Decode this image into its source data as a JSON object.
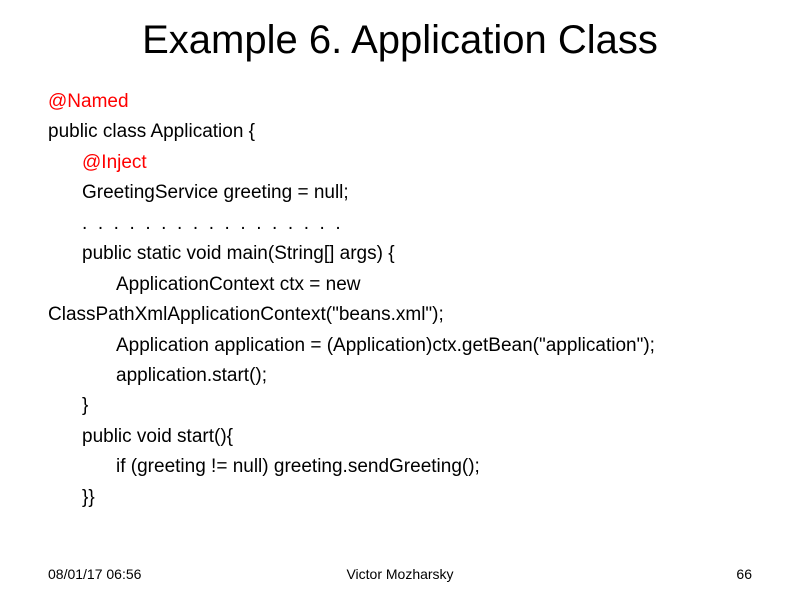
{
  "title": "Example 6. Application Class",
  "code": {
    "line1": "@Named",
    "line2": "public class Application {",
    "line3": "@Inject",
    "line4": "GreetingService greeting = null;",
    "line5": ".  .  .  .  .  .  .  .  .  .  .  .  .  .  .  .  .",
    "line6": "public static void main(String[] args) {",
    "line7a": "ApplicationContext ctx = new",
    "line7b": "ClassPathXmlApplicationContext(\"beans.xml\");",
    "line8": "Application application = (Application)ctx.getBean(\"application\");",
    "line9": "application.start();",
    "line10": "}",
    "line11": "public void start(){",
    "line12": "if (greeting != null) greeting.sendGreeting();",
    "line13": "}}"
  },
  "footer": {
    "date": "08/01/17 06:56",
    "author": "Victor Mozharsky",
    "page": "66"
  }
}
